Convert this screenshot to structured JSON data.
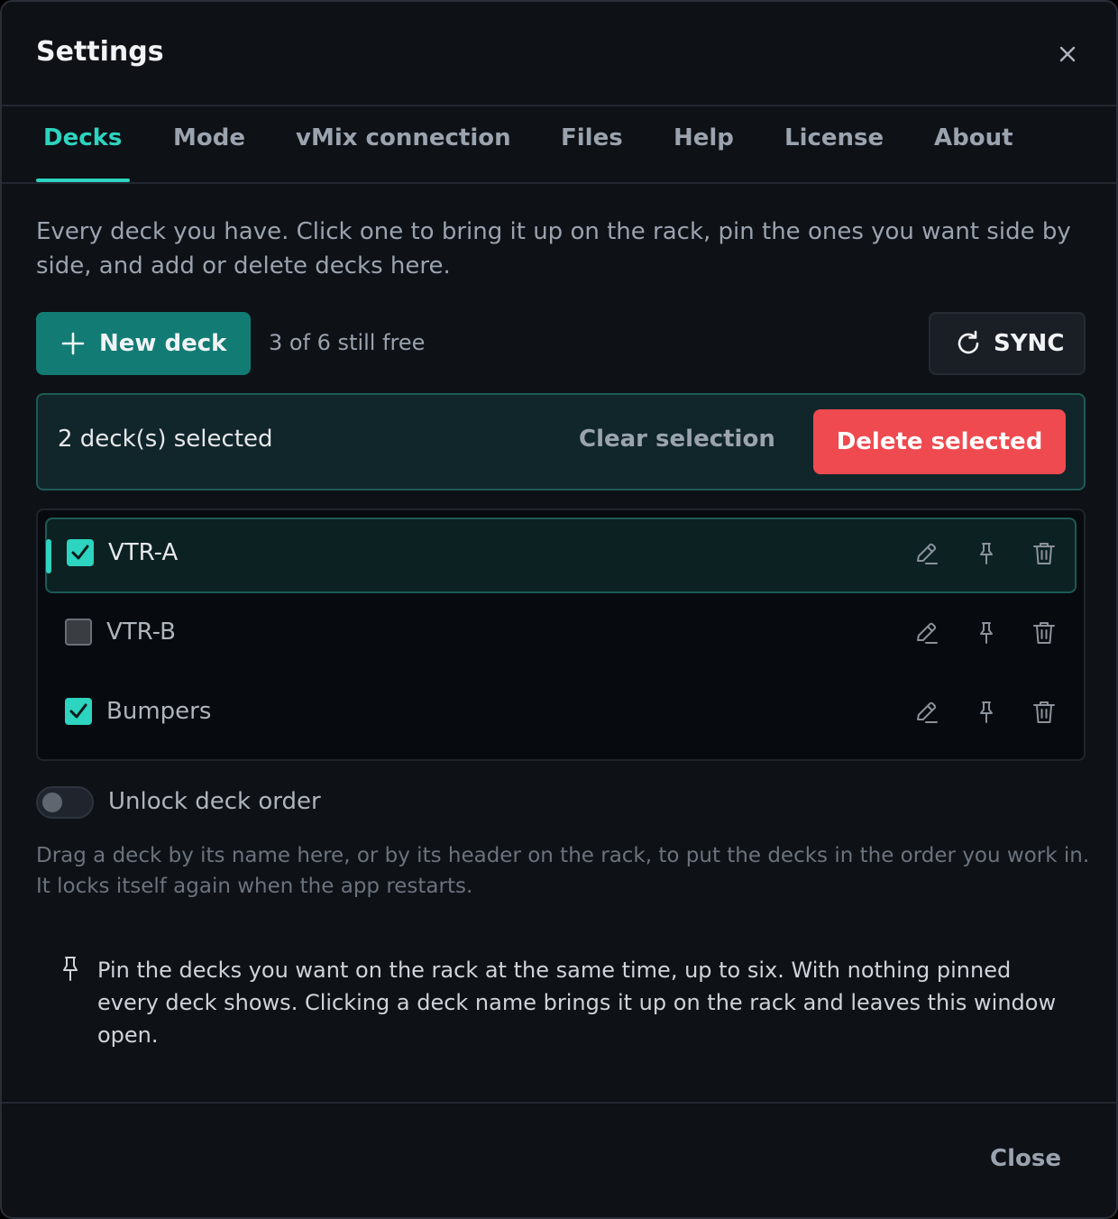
{
  "dialog": {
    "title": "Settings"
  },
  "tabs": [
    {
      "label": "Decks",
      "active": true
    },
    {
      "label": "Mode"
    },
    {
      "label": "vMix connection"
    },
    {
      "label": "Files"
    },
    {
      "label": "Help"
    },
    {
      "label": "License"
    },
    {
      "label": "About"
    }
  ],
  "decks_panel": {
    "intro": "Every deck you have. Click one to bring it up on the rack, pin the ones you want side by side, and add or delete decks here.",
    "new_deck_label": "New deck",
    "free_text": "3 of 6 still free",
    "sync_label": "SYNC",
    "selection": {
      "count_text": "2 deck(s) selected",
      "clear_label": "Clear selection",
      "delete_label": "Delete selected"
    },
    "decks": [
      {
        "name": "VTR-A",
        "checked": true,
        "active": true
      },
      {
        "name": "VTR-B",
        "checked": false
      },
      {
        "name": "Bumpers",
        "checked": true
      }
    ],
    "unlock_label": "Unlock deck order",
    "unlock_on": false,
    "drag_hint": "Drag a deck by its name here, or by its header on the rack, to put the decks in the order you work in. It locks itself again when the app restarts.",
    "pin_note": "Pin the decks you want on the rack at the same time, up to six. With nothing pinned every deck shows. Clicking a deck name brings it up on the rack and leaves this window open."
  },
  "footer": {
    "close_label": "Close"
  },
  "colors": {
    "accent": "#2dd4bf",
    "primary_button": "#127c74",
    "danger": "#ef4a4f",
    "background": "#0e1116"
  }
}
